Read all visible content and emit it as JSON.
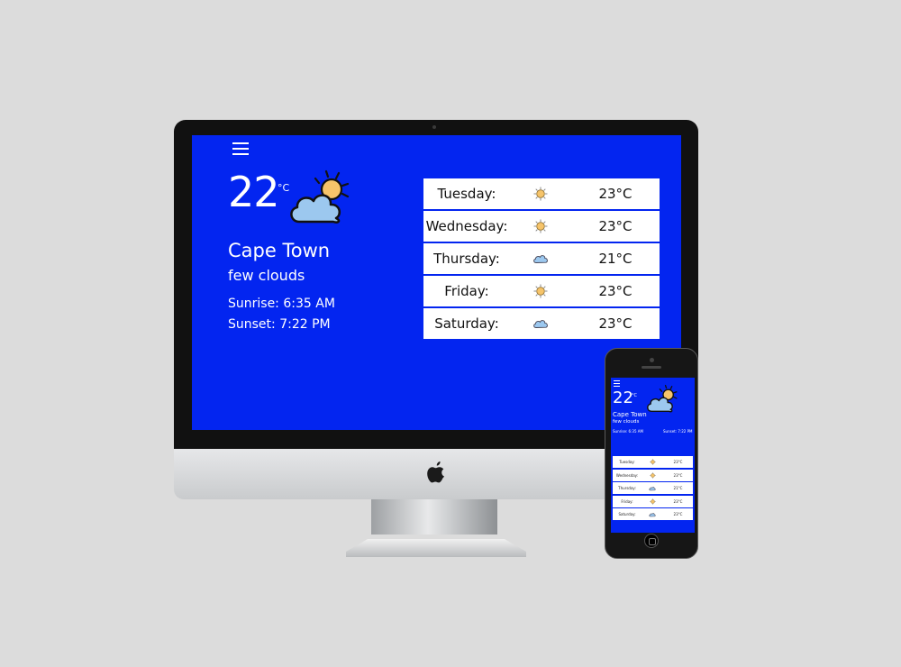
{
  "current": {
    "temperature": "22",
    "unit": "°C",
    "icon": "sun-behind-cloud-icon",
    "city": "Cape Town",
    "description": "few clouds",
    "sunrise": "Sunrise: 6:35 AM",
    "sunset": "Sunset: 7:22 PM"
  },
  "forecast": [
    {
      "day": "Tuesday:",
      "icon": "sun-icon",
      "temp": "23°C"
    },
    {
      "day": "Wednesday:",
      "icon": "sun-icon",
      "temp": "23°C"
    },
    {
      "day": "Thursday:",
      "icon": "cloud-icon",
      "temp": "21°C"
    },
    {
      "day": "Friday:",
      "icon": "sun-icon",
      "temp": "23°C"
    },
    {
      "day": "Saturday:",
      "icon": "cloud-icon",
      "temp": "23°C"
    }
  ],
  "colors": {
    "background": "#dcdcdc",
    "app_background": "#0325f0",
    "text": "#ffffff",
    "card": "#ffffff"
  }
}
